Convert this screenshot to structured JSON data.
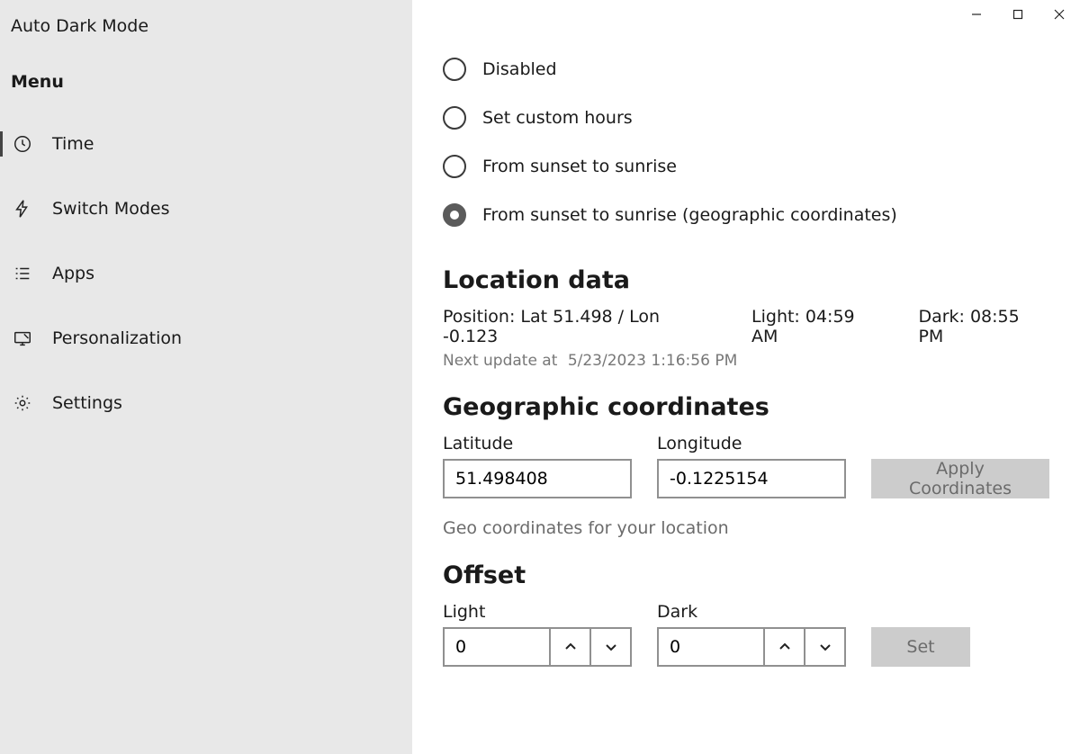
{
  "app_title": "Auto Dark Mode",
  "menu_label": "Menu",
  "sidebar": {
    "items": [
      {
        "label": "Time",
        "icon": "clock-icon",
        "selected": true
      },
      {
        "label": "Switch Modes",
        "icon": "lightning-icon",
        "selected": false
      },
      {
        "label": "Apps",
        "icon": "list-icon",
        "selected": false
      },
      {
        "label": "Personalization",
        "icon": "personalization-icon",
        "selected": false
      },
      {
        "label": "Settings",
        "icon": "gear-icon",
        "selected": false
      }
    ]
  },
  "mode_options": [
    {
      "label": "Disabled",
      "selected": false
    },
    {
      "label": "Set custom hours",
      "selected": false
    },
    {
      "label": "From sunset to sunrise",
      "selected": false
    },
    {
      "label": "From sunset to sunrise (geographic coordinates)",
      "selected": true
    }
  ],
  "location": {
    "heading": "Location data",
    "position": "Position: Lat 51.498 / Lon -0.123",
    "light": "Light: 04:59 AM",
    "dark": "Dark: 08:55 PM",
    "next_update_label": "Next update at",
    "next_update_ts": "5/23/2023 1:16:56 PM"
  },
  "geo": {
    "heading": "Geographic coordinates",
    "lat_label": "Latitude",
    "lat_value": "51.498408",
    "lon_label": "Longitude",
    "lon_value": "-0.1225154",
    "apply_label": "Apply Coordinates",
    "hint": "Geo coordinates for your location"
  },
  "offset": {
    "heading": "Offset",
    "light_label": "Light",
    "light_value": "0",
    "dark_label": "Dark",
    "dark_value": "0",
    "set_label": "Set"
  }
}
